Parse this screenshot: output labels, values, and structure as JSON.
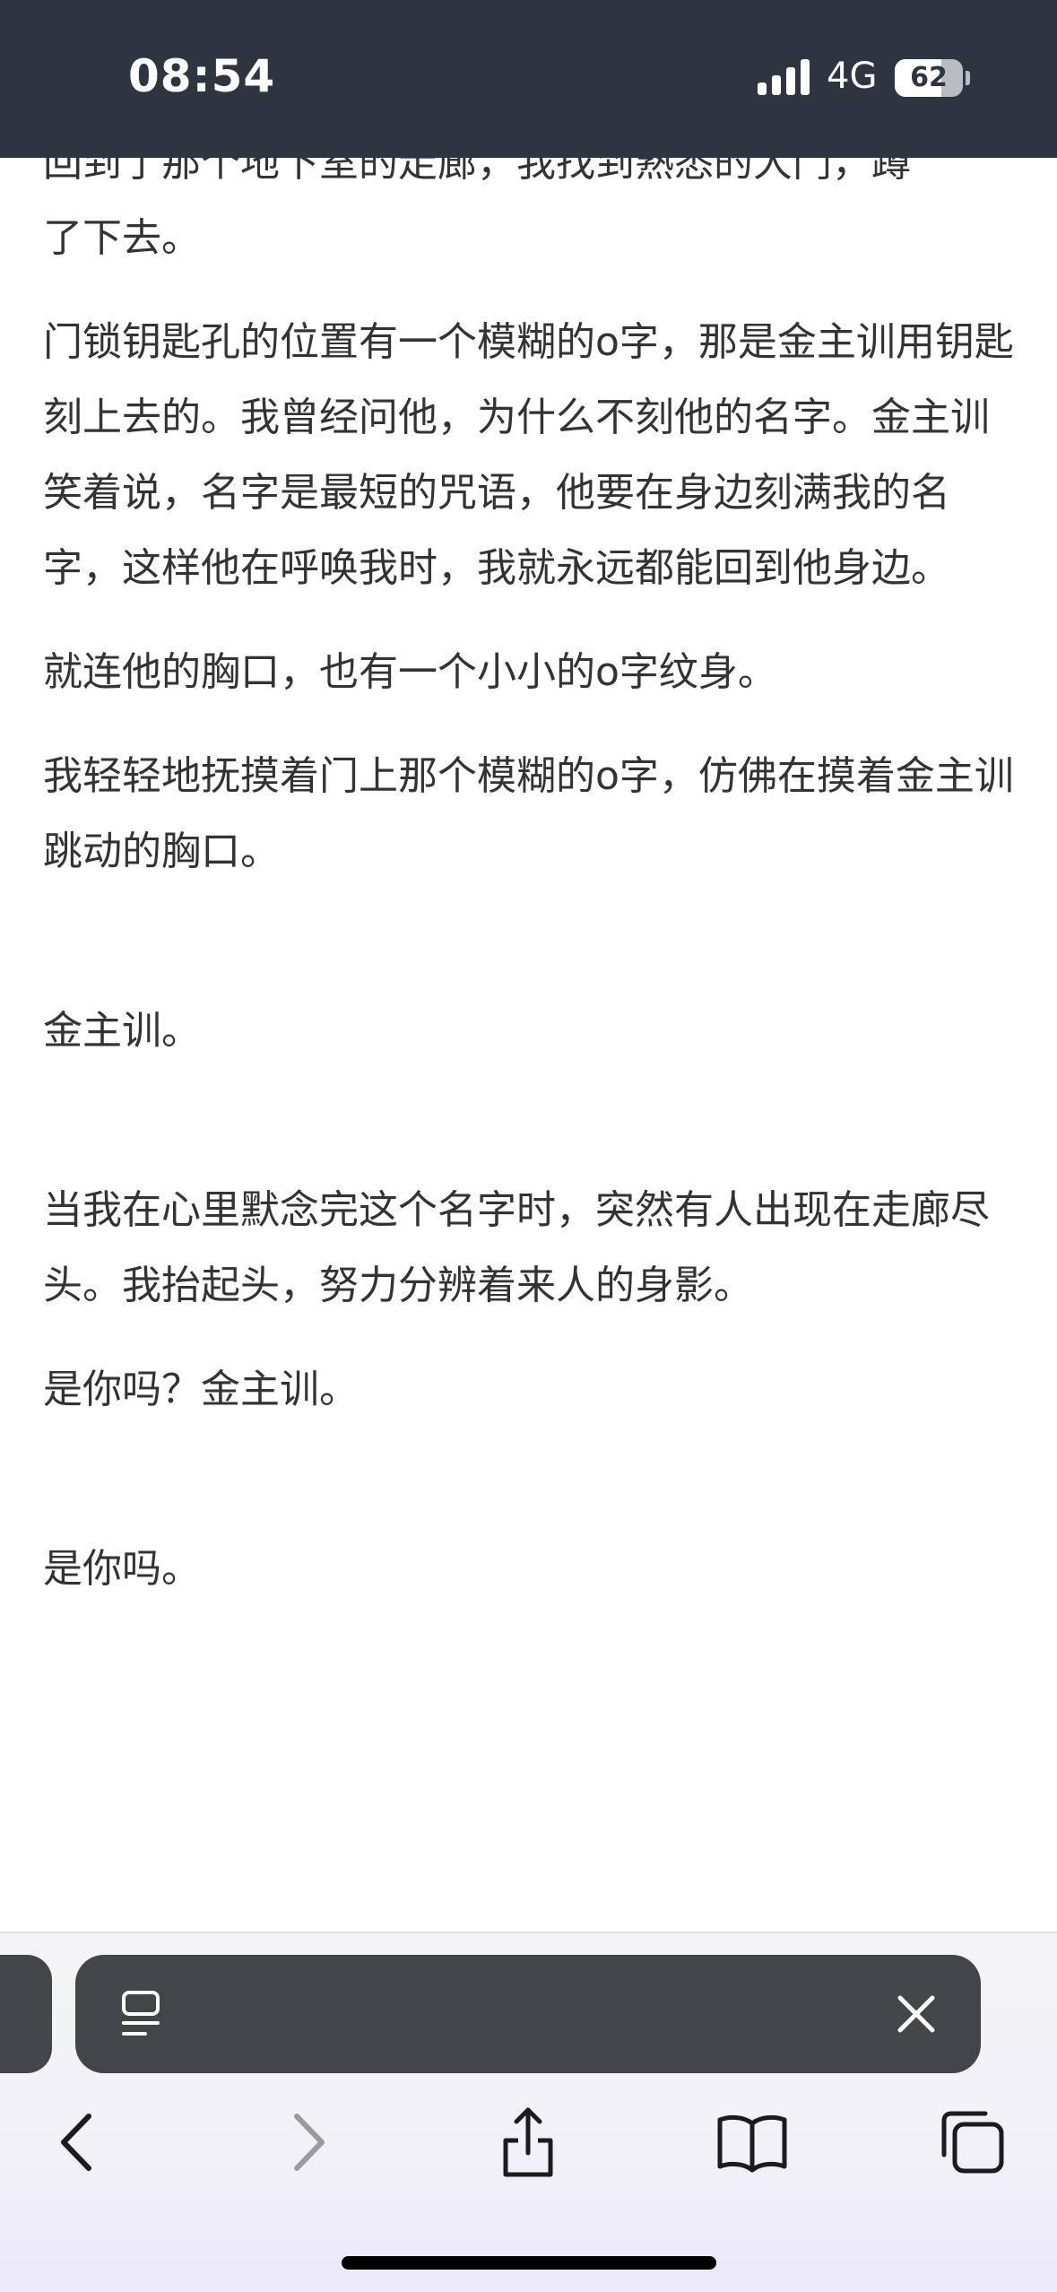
{
  "status_bar": {
    "time": "08:54",
    "network": "4G",
    "battery_level": "62",
    "icons": [
      "signal-icon",
      "battery-icon"
    ]
  },
  "article": {
    "partial_line": "回到了那个地下室的走廊，我找到熟悉的大门，蹲",
    "p1": "了下去。",
    "p2": "门锁钥匙孔的位置有一个模糊的o字，那是金主训用钥匙刻上去的。我曾经问他，为什么不刻他的名字。金主训笑着说，名字是最短的咒语，他要在身边刻满我的名字，这样他在呼唤我时，我就永远都能回到他身边。",
    "p3": "就连他的胸口，也有一个小小的o字纹身。",
    "p4": "我轻轻地抚摸着门上那个模糊的o字，仿佛在摸着金主训跳动的胸口。",
    "p5": "金主训。",
    "p6": "当我在心里默念完这个名字时，突然有人出现在走廊尽头。我抬起头，努力分辨着来人的身影。",
    "p7": "是你吗？金主训。",
    "p8": "是你吗。"
  },
  "browser_chrome": {
    "icons": [
      "reader-icon",
      "close-icon",
      "back-icon",
      "forward-icon",
      "share-icon",
      "bookmarks-icon",
      "tabs-icon"
    ],
    "colors": {
      "status_bg": "#2f3441",
      "tab_pill_bg": "#444548",
      "toolbar_icon": "#1c1c1e",
      "disabled_icon": "#9a9aa0"
    }
  }
}
